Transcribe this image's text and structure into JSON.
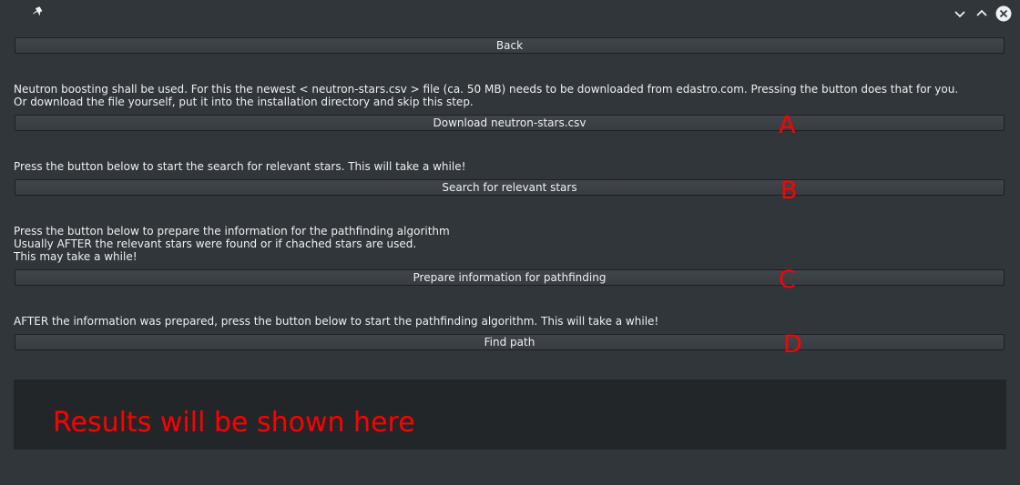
{
  "titlebar": {
    "icon": "pin-icon",
    "controls": [
      "chevron-down-icon",
      "chevron-up-icon",
      "close-icon"
    ]
  },
  "back_button": "Back",
  "section_a": {
    "description_line1": "Neutron boosting shall be used. For this the newest < neutron-stars.csv > file (ca. 50 MB) needs to be downloaded from edastro.com. Pressing the button does that for you.",
    "description_line2": "Or download the file yourself, put it into the installation directory and skip this step.",
    "button": "Download neutron-stars.csv",
    "marker": "A"
  },
  "section_b": {
    "description": "Press the button below to start the search for relevant stars. This will take a while!",
    "button": "Search for relevant stars",
    "marker": "B"
  },
  "section_c": {
    "description_line1": "Press the button below to prepare the information for the pathfinding algorithm",
    "description_line2": "Usually AFTER the relevant stars were found or if chached stars are used.",
    "description_line3": "This may take a while!",
    "button": "Prepare information for pathfinding",
    "marker": "C"
  },
  "section_d": {
    "description": "AFTER the information was prepared, press the button below to start the pathfinding algorithm. This will take a while!",
    "button": "Find path",
    "marker": "D"
  },
  "results": {
    "text": "Results will be shown here"
  },
  "colors": {
    "background": "#31363b",
    "annotation": "#ff0000",
    "results_bg": "#232629"
  }
}
